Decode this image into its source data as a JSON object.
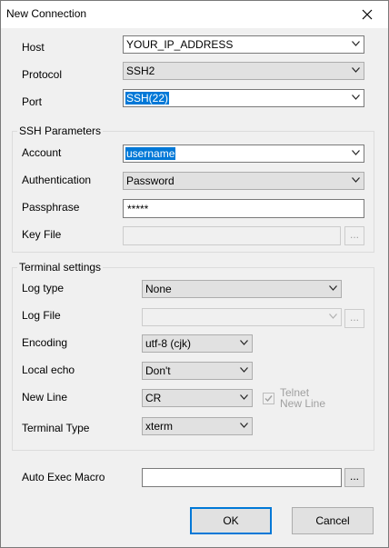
{
  "window": {
    "title": "New Connection"
  },
  "host": {
    "label": "Host",
    "value": "YOUR_IP_ADDRESS"
  },
  "protocol": {
    "label": "Protocol",
    "value": "SSH2"
  },
  "port": {
    "label": "Port",
    "value": "SSH(22)"
  },
  "ssh": {
    "group_title": "SSH Parameters",
    "account": {
      "label": "Account",
      "value": "username"
    },
    "authentication": {
      "label": "Authentication",
      "value": "Password"
    },
    "passphrase": {
      "label": "Passphrase",
      "value": "*****"
    },
    "key_file": {
      "label": "Key File",
      "value": "",
      "browse_label": "..."
    }
  },
  "terminal": {
    "group_title": "Terminal settings",
    "log_type": {
      "label": "Log type",
      "value": "None"
    },
    "log_file": {
      "label": "Log File",
      "value": "",
      "browse_label": "..."
    },
    "encoding": {
      "label": "Encoding",
      "value": "utf-8 (cjk)"
    },
    "local_echo": {
      "label": "Local echo",
      "value": "Don't"
    },
    "new_line": {
      "label": "New Line",
      "value": "CR",
      "telnet_line1": "Telnet",
      "telnet_line2": "New Line",
      "telnet_checked": true
    },
    "terminal_type": {
      "label": "Terminal Type",
      "value": "xterm"
    }
  },
  "macro": {
    "label": "Auto Exec Macro",
    "value": "",
    "browse_label": "..."
  },
  "buttons": {
    "ok": "OK",
    "cancel": "Cancel"
  },
  "colors": {
    "accent": "#0078d7",
    "dialog_bg": "#f0f0f0"
  },
  "icons": {
    "close": "close-icon",
    "dropdown": "chevron-down-icon",
    "check": "check-icon"
  }
}
